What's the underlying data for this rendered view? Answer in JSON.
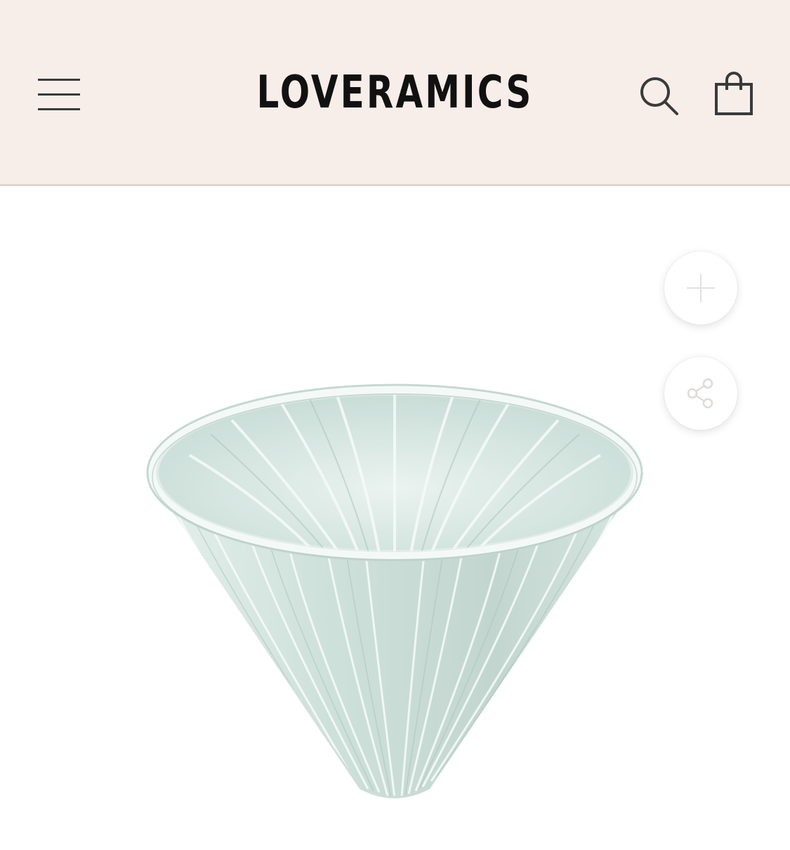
{
  "header": {
    "brand": "LOVERAMICS",
    "background_color": "#f7eeea",
    "icons": {
      "menu": "hamburger-menu-icon",
      "search": "search-icon",
      "cart": "shopping-bag-icon"
    }
  },
  "product": {
    "image_icon": "pour-over-dripper-image",
    "glaze_color": "#c9ddd7",
    "actions": {
      "zoom": "plus-icon",
      "share": "share-icon"
    }
  }
}
